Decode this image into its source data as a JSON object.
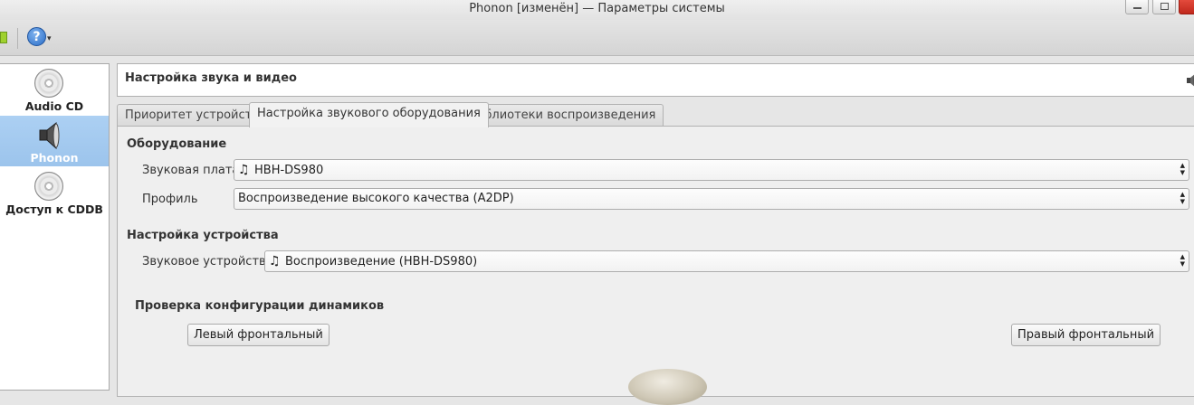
{
  "window": {
    "title": "Phonon [изменён] — Параметры системы"
  },
  "toolbar": {
    "help_glyph": "?",
    "help_arrow": "▾"
  },
  "sidebar": {
    "items": [
      {
        "label": "Audio CD",
        "icon": "cd-icon",
        "selected": false
      },
      {
        "label": "Phonon",
        "icon": "speaker-icon",
        "selected": true
      },
      {
        "label": "Доступ к CDDB",
        "icon": "cd-icon",
        "selected": false
      }
    ]
  },
  "header": {
    "title": "Настройка звука и видео"
  },
  "tabs": [
    {
      "label": "Приоритет устройств",
      "active": false
    },
    {
      "label": "Настройка звукового оборудования",
      "active": true
    },
    {
      "label": "Библиотеки воспроизведения",
      "active": false
    }
  ],
  "hardware": {
    "section_title": "Оборудование",
    "sound_card_label": "Звуковая плата",
    "sound_card_value": "HBH-DS980",
    "profile_label": "Профиль",
    "profile_value": "Воспроизведение высокого качества (A2DP)"
  },
  "device": {
    "section_title": "Настройка устройства",
    "sound_device_label": "Звуковое устройство",
    "sound_device_value": "Воспроизведение (HBH-DS980)"
  },
  "speaker_test": {
    "section_title": "Проверка конфигурации динамиков",
    "left_front_label": "Левый фронтальный",
    "right_front_label": "Правый фронтальный"
  },
  "glyphs": {
    "note": "♫",
    "combo_arrows": "▲▼"
  }
}
